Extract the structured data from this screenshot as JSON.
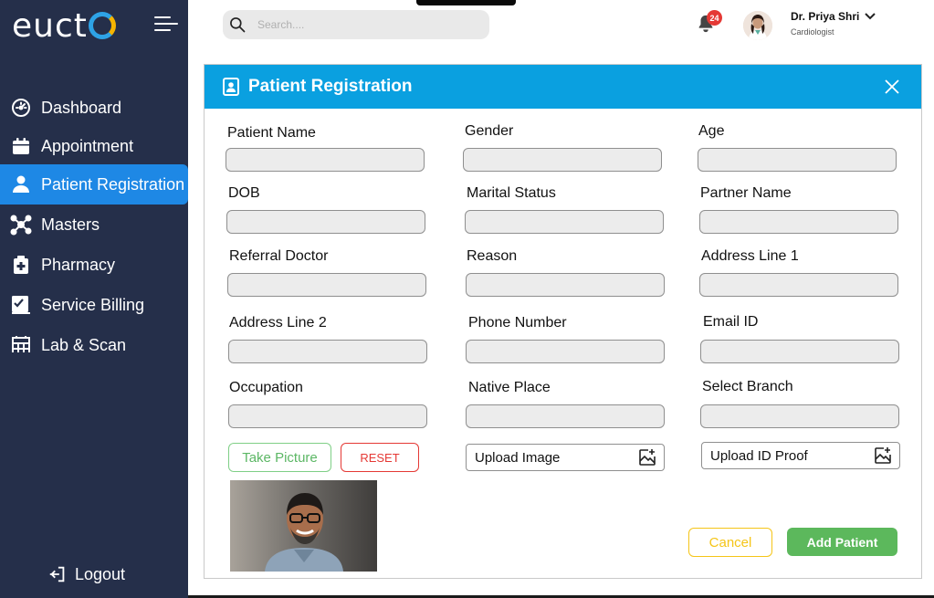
{
  "app": {
    "logo_text": "euct"
  },
  "sidebar": {
    "items": [
      {
        "label": "Dashboard",
        "icon": "gauge-icon"
      },
      {
        "label": "Appointment",
        "icon": "calendar-icon"
      },
      {
        "label": "Patient Registration",
        "icon": "person-icon",
        "active": true
      },
      {
        "label": "Masters",
        "icon": "network-icon"
      },
      {
        "label": "Pharmacy",
        "icon": "medical-bag-icon"
      },
      {
        "label": "Service Billing",
        "icon": "billing-icon"
      },
      {
        "label": "Lab & Scan",
        "icon": "lab-icon"
      }
    ],
    "logout_label": "Logout"
  },
  "header": {
    "search_placeholder": "Search....",
    "notification_count": "24",
    "user_name": "Dr. Priya Shri",
    "user_role": "Cardiologist"
  },
  "modal": {
    "title": "Patient Registration",
    "fields": {
      "patient_name": "Patient Name",
      "gender": "Gender",
      "age": "Age",
      "dob": "DOB",
      "marital_status": "Marital Status",
      "partner_name": "Partner Name",
      "referral_doctor": "Referral Doctor",
      "reason": "Reason",
      "address_line_1": "Address Line 1",
      "address_line_2": "Address Line 2",
      "phone_number": "Phone Number",
      "email_id": "Email ID",
      "occupation": "Occupation",
      "native_place": "Native Place",
      "select_branch": "Select Branch"
    },
    "buttons": {
      "take_picture": "Take Picture",
      "reset": "RESET",
      "upload_image": "Upload Image",
      "upload_id_proof": "Upload ID Proof",
      "cancel": "Cancel",
      "add_patient": "Add Patient"
    }
  },
  "colors": {
    "sidebar_bg": "#252f4a",
    "active_item": "#1e88e5",
    "modal_header": "#0aa0e0",
    "success": "#5cb85c",
    "danger": "#e53935",
    "warning": "#f5c518"
  }
}
